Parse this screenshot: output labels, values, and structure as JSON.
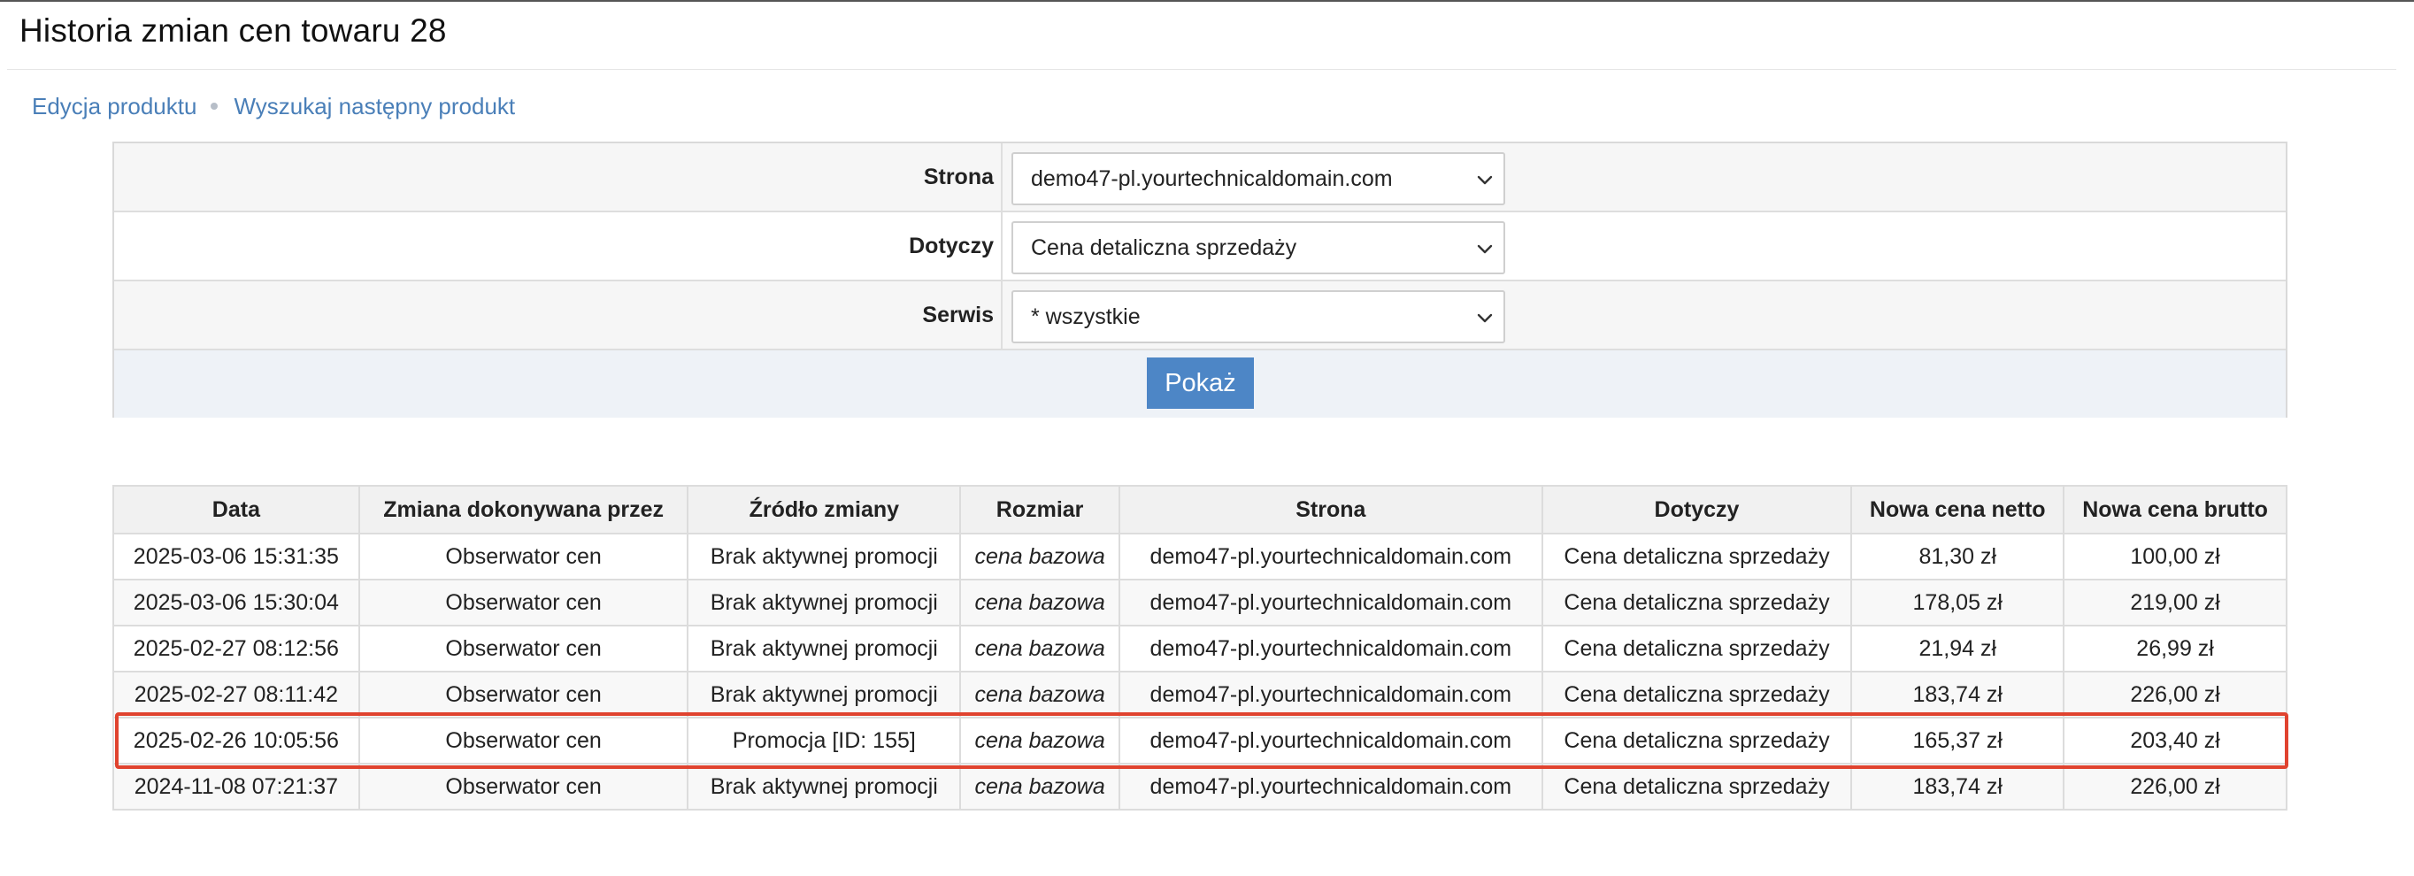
{
  "page": {
    "title": "Historia zmian cen towaru 28"
  },
  "breadcrumb": {
    "items": [
      {
        "label": "Edycja produktu"
      },
      {
        "label": "Wyszukaj następny produkt"
      }
    ]
  },
  "filters": {
    "site": {
      "label": "Strona",
      "value": "demo47-pl.yourtechnicaldomain.com"
    },
    "applies_to": {
      "label": "Dotyczy",
      "value": "Cena detaliczna sprzedaży"
    },
    "service": {
      "label": "Serwis",
      "value": "* wszystkie"
    },
    "submit_label": "Pokaż"
  },
  "table": {
    "columns": [
      "Data",
      "Zmiana dokonywana przez",
      "Źródło zmiany",
      "Rozmiar",
      "Strona",
      "Dotyczy",
      "Nowa cena netto",
      "Nowa cena brutto"
    ],
    "rows": [
      [
        "2025-03-06 15:31:35",
        "Obserwator cen",
        "Brak aktywnej promocji",
        "cena bazowa",
        "demo47-pl.yourtechnicaldomain.com",
        "Cena detaliczna sprzedaży",
        "81,30 zł",
        "100,00 zł"
      ],
      [
        "2025-03-06 15:30:04",
        "Obserwator cen",
        "Brak aktywnej promocji",
        "cena bazowa",
        "demo47-pl.yourtechnicaldomain.com",
        "Cena detaliczna sprzedaży",
        "178,05 zł",
        "219,00 zł"
      ],
      [
        "2025-02-27 08:12:56",
        "Obserwator cen",
        "Brak aktywnej promocji",
        "cena bazowa",
        "demo47-pl.yourtechnicaldomain.com",
        "Cena detaliczna sprzedaży",
        "21,94 zł",
        "26,99 zł"
      ],
      [
        "2025-02-27 08:11:42",
        "Obserwator cen",
        "Brak aktywnej promocji",
        "cena bazowa",
        "demo47-pl.yourtechnicaldomain.com",
        "Cena detaliczna sprzedaży",
        "183,74 zł",
        "226,00 zł"
      ],
      [
        "2025-02-26 10:05:56",
        "Obserwator cen",
        "Promocja [ID: 155]",
        "cena bazowa",
        "demo47-pl.yourtechnicaldomain.com",
        "Cena detaliczna sprzedaży",
        "165,37 zł",
        "203,40 zł"
      ],
      [
        "2024-11-08 07:21:37",
        "Obserwator cen",
        "Brak aktywnej promocji",
        "cena bazowa",
        "demo47-pl.yourtechnicaldomain.com",
        "Cena detaliczna sprzedaży",
        "183,74 zł",
        "226,00 zł"
      ]
    ],
    "highlighted_row": 4
  },
  "colors": {
    "link": "#4a7fb8",
    "button": "#4d86c6",
    "highlight": "#e0432f"
  }
}
